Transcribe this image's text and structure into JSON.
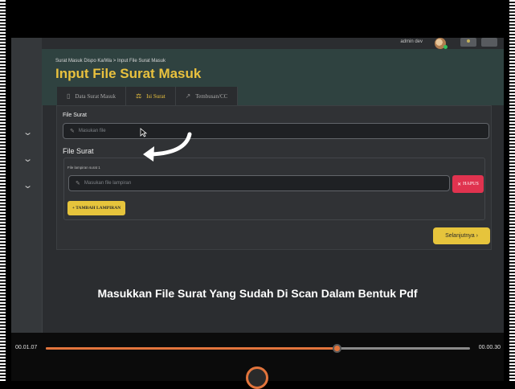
{
  "topbar": {
    "user_name": "admin dev"
  },
  "header": {
    "breadcrumb": "Surat Masuk Dispo Ka/Wa > Input File Surat Masuk",
    "title": "Input File Surat Masuk"
  },
  "tabs": [
    {
      "label": "Data Surat Masuk",
      "icon": "document-icon",
      "active": false
    },
    {
      "label": "Isi Surat",
      "icon": "scale-icon",
      "active": true
    },
    {
      "label": "Tembusan/CC",
      "icon": "share-arrow-icon",
      "active": false
    }
  ],
  "form": {
    "file_label": "File Surat",
    "file_placeholder": "Masukan file",
    "attachments_heading": "File Surat",
    "attachment_label": "File lampiran surat 1",
    "attachment_placeholder": "Masukan file lampiran",
    "delete_label": "HAPUS",
    "add_label": "+ TAMBAH LAMPIRAN",
    "next_label": "Selanjutnya ›"
  },
  "caption": "Masukkan File Surat Yang Sudah Di Scan Dalam Bentuk Pdf",
  "player": {
    "current_time": "00.01.07",
    "duration": "00.00.30",
    "progress": 0.685,
    "accent_color": "#e2743c"
  },
  "colors": {
    "title": "#e9c13e",
    "danger": "#e0334f",
    "primary": "#e6c43c"
  }
}
